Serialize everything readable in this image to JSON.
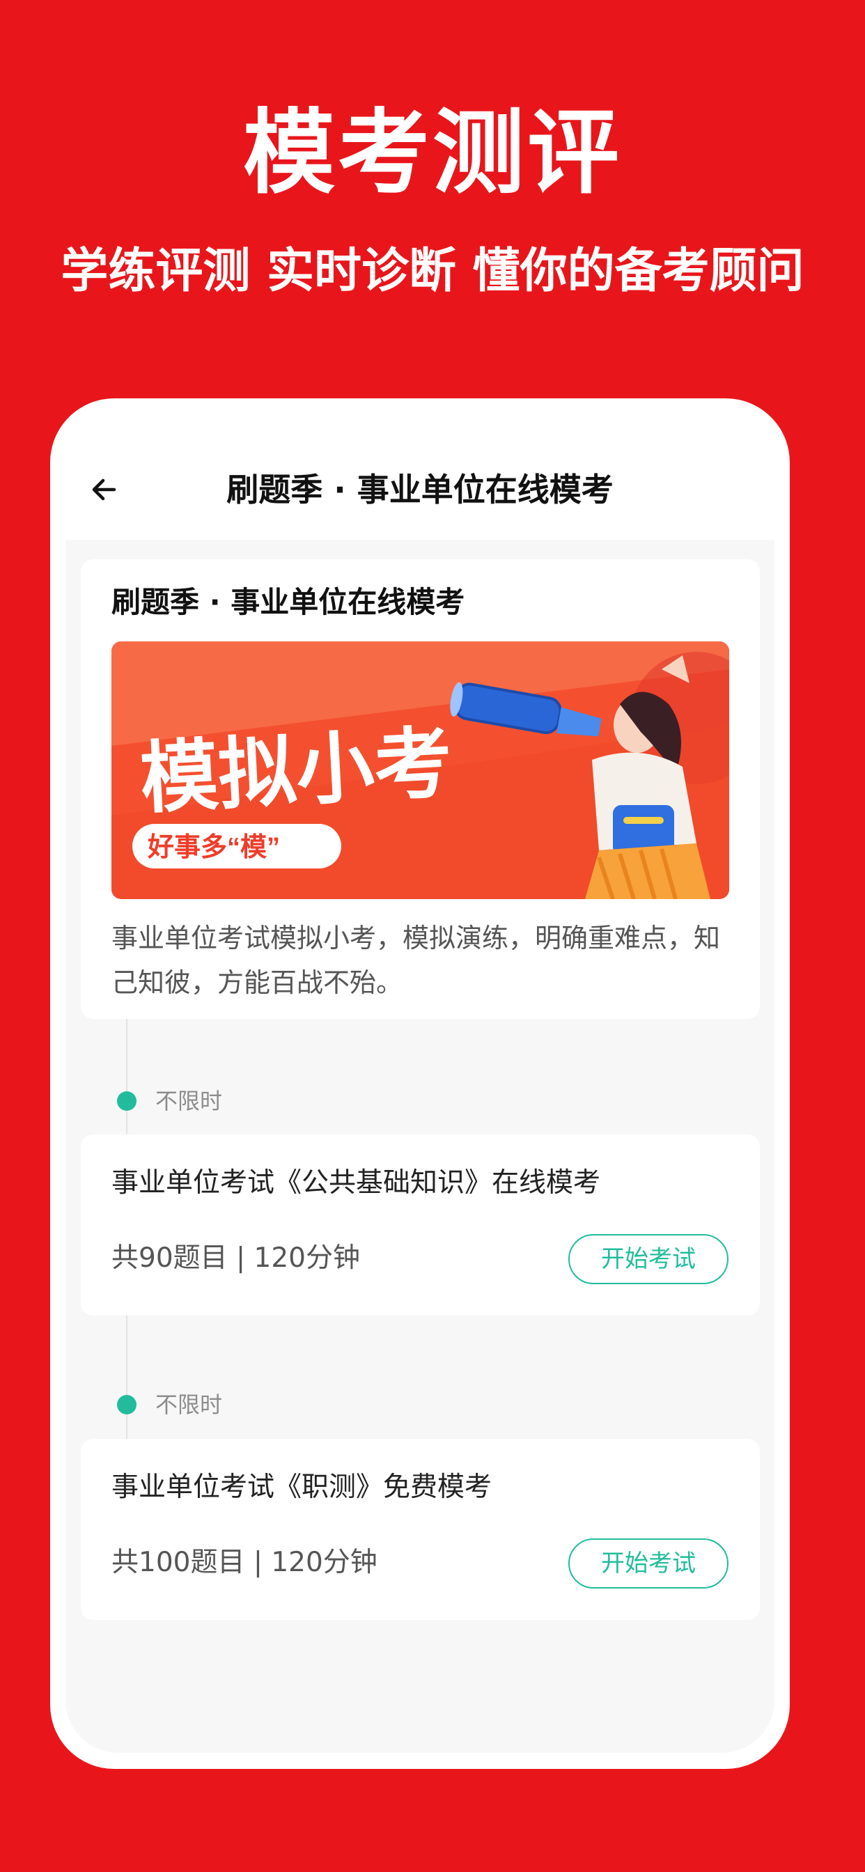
{
  "promo": {
    "title": "模考测评",
    "subtitle": "学练评测  实时诊断  懂你的备考顾问"
  },
  "nav": {
    "back_icon": "arrow-left-icon",
    "title": "刷题季 · 事业单位在线模考"
  },
  "intro_card": {
    "title": "刷题季 · 事业单位在线模考",
    "banner": {
      "headline": "模拟小考",
      "tagline": "好事多“模”"
    },
    "description": "事业单位考试模拟小考，模拟演练，明确重难点，知己知彼，方能百战不殆。"
  },
  "exams": [
    {
      "time_label": "不限时",
      "title": "事业单位考试《公共基础知识》在线模考",
      "meta": "共90题目 | 120分钟",
      "button_label": "开始考试"
    },
    {
      "time_label": "不限时",
      "title": "事业单位考试《职测》免费模考",
      "meta": "共100题目 | 120分钟",
      "button_label": "开始考试"
    }
  ],
  "colors": {
    "brand_red": "#E8161B",
    "accent_green": "#22BC9C"
  }
}
